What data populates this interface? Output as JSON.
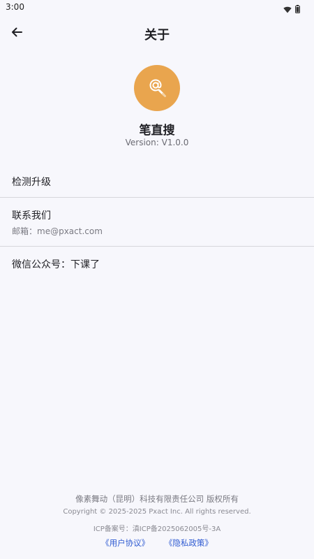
{
  "status_bar": {
    "time": "3:00",
    "icons": [
      "wifi-icon",
      "battery-icon"
    ]
  },
  "header": {
    "title": "关于",
    "back_icon": "arrow-left-icon"
  },
  "app": {
    "logo_icon": "at-pencil-icon",
    "logo_color": "#e9a54e",
    "name": "笔直搜",
    "version": "Version: V1.0.0"
  },
  "menu": {
    "check_update": "检测升级",
    "contact_title": "联系我们",
    "contact_email": "邮箱：me@pxact.com",
    "wechat": "微信公众号：下课了"
  },
  "footer": {
    "company": "像素舞动（昆明）科技有限责任公司 版权所有",
    "copyright": "Copyright © 2025-2025 Pxact Inc. All rights reserved.",
    "icp": "ICP备案号：滇ICP备2025062005号-3A",
    "user_agreement": "《用户协议》",
    "privacy_policy": "《隐私政策》",
    "link_color": "#2f5bd2"
  }
}
